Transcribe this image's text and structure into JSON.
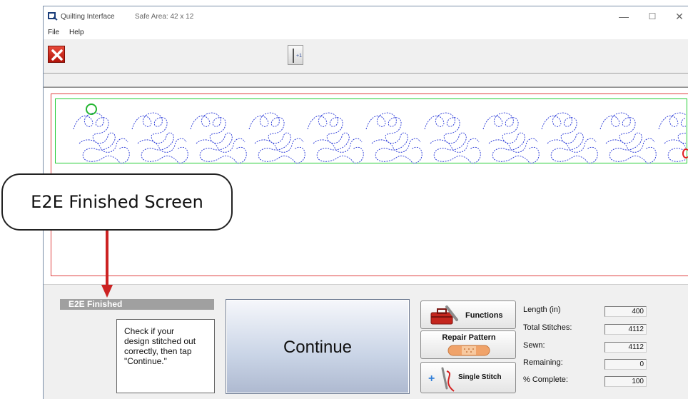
{
  "window": {
    "title": "Quilting Interface",
    "safe_area": "Safe Area:  42 x 12",
    "controls": {
      "minimize": "—",
      "maximize": "☐",
      "close": "✕"
    }
  },
  "menu": {
    "file": "File",
    "help": "Help"
  },
  "toolbar": {
    "exit_icon": "exit-x-icon",
    "needle_icon": "needle-plus-one-icon",
    "needle_badge": "+1"
  },
  "status": {
    "header": "E2E Finished",
    "instruction": "Check if your\ndesign stitched out\ncorrectly, then tap\n\"Continue.\""
  },
  "actions": {
    "continue": "Continue",
    "functions": "Functions",
    "repair": "Repair Pattern",
    "single_stitch": "Single Stitch"
  },
  "stats": [
    {
      "label": "Length (in)",
      "value": "400"
    },
    {
      "label": "Total Stitches:",
      "value": "4112"
    },
    {
      "label": "Sewn:",
      "value": "4112"
    },
    {
      "label": "Remaining:",
      "value": "0"
    },
    {
      "label": "% Complete:",
      "value": "100"
    }
  ],
  "callout": {
    "text": "E2E Finished Screen"
  },
  "colors": {
    "pattern_stitch": "#1f2fd6",
    "safe_area_border": "#22cc33",
    "frame_border": "#e04040",
    "callout_arrow": "#cc2222"
  }
}
